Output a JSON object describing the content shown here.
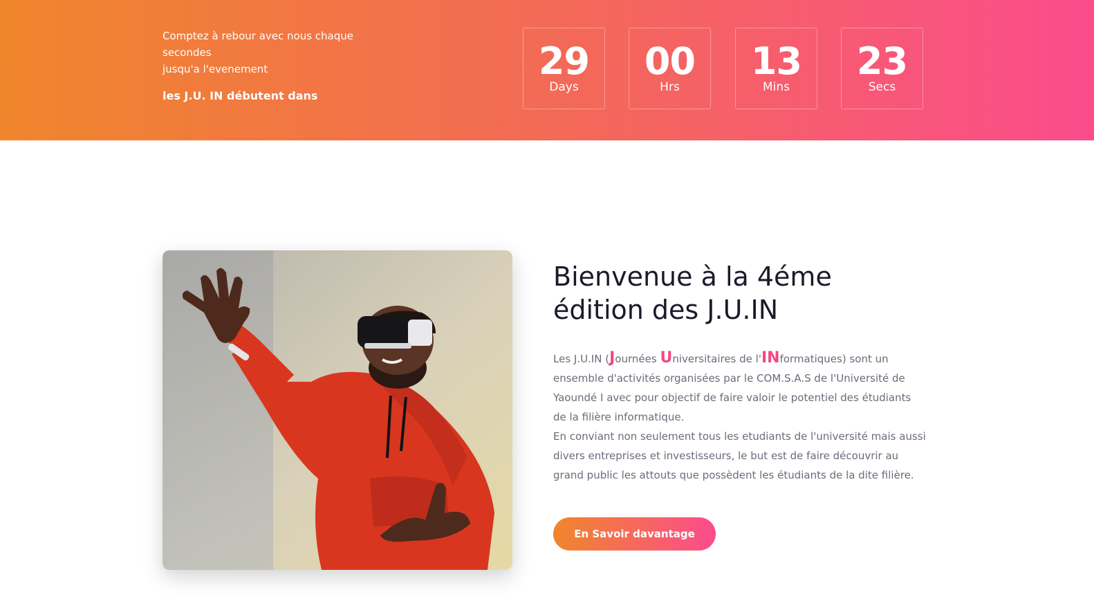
{
  "countdown": {
    "intro_line1": "Comptez à rebour avec nous chaque",
    "intro_line2": "secondes",
    "intro_line3": "jusqu'a l'evenement",
    "headline": "les J.U. IN débutent dans",
    "items": [
      {
        "value": "29",
        "unit": "Days"
      },
      {
        "value": "00",
        "unit": "Hrs"
      },
      {
        "value": "13",
        "unit": "Mins"
      },
      {
        "value": "23",
        "unit": "Secs"
      }
    ]
  },
  "about": {
    "title": "Bienvenue à la 4éme édition des J.U.IN",
    "body": {
      "p1_prefix": "Les J.U.IN (",
      "j": "J",
      "p1_part2": "ournées ",
      "u": "U",
      "p1_part3": "niversitaires de l'",
      "in": "IN",
      "p1_rest": "formatiques) sont un ensemble d'activités organisées par le COM.S.A.S de l'Université de Yaoundé I avec pour objectif de faire valoir le potentiel des étudiants de la filière informatique.",
      "p2": "En conviant non seulement tous les etudiants de l'université mais aussi divers entreprises et investisseurs, le but est de faire découvrir au grand public les attouts que possèdent les étudiants de la dite filière."
    },
    "cta_label": "En Savoir davantage"
  },
  "colors": {
    "gradient_start": "#f0862c",
    "gradient_end": "#fb4c8c",
    "accent": "#f4477f",
    "title": "#1a1a2a",
    "body": "#6b6b7b"
  }
}
